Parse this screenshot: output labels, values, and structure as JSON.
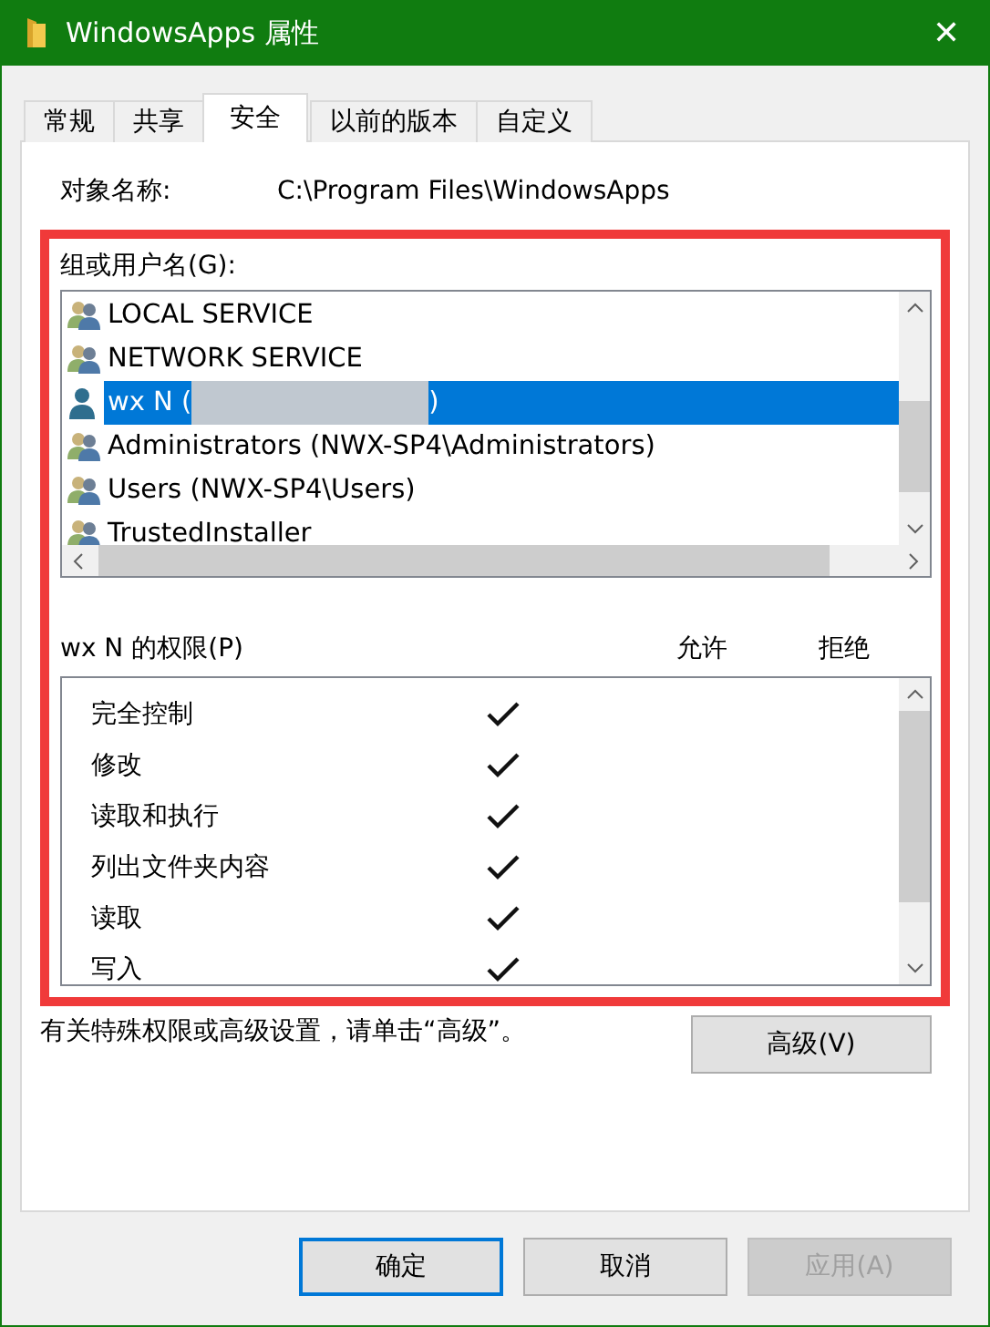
{
  "window": {
    "title": "WindowsApps 属性",
    "close": "✕"
  },
  "tabs": [
    {
      "label": "常规",
      "selected": false
    },
    {
      "label": "共享",
      "selected": false
    },
    {
      "label": "安全",
      "selected": true
    },
    {
      "label": "以前的版本",
      "selected": false
    },
    {
      "label": "自定义",
      "selected": false
    }
  ],
  "object_name": {
    "label": "对象名称:",
    "value": "C:\\Program Files\\WindowsApps"
  },
  "groups": {
    "label": "组或用户名(G):",
    "items": [
      {
        "kind": "group",
        "label": "LOCAL SERVICE",
        "selected": false
      },
      {
        "kind": "group",
        "label": "NETWORK SERVICE",
        "selected": false
      },
      {
        "kind": "user",
        "label": "wx N (",
        "label_end": ")",
        "redacted": true,
        "selected": true
      },
      {
        "kind": "group",
        "label": "Administrators (NWX-SP4\\Administrators)",
        "selected": false
      },
      {
        "kind": "group",
        "label": "Users (NWX-SP4\\Users)",
        "selected": false
      },
      {
        "kind": "group",
        "label": "TrustedInstaller",
        "selected": false
      }
    ]
  },
  "permissions": {
    "label": "wx N 的权限(P)",
    "allow_header": "允许",
    "deny_header": "拒绝",
    "rows": [
      {
        "label": "完全控制",
        "allow": true,
        "deny": false
      },
      {
        "label": "修改",
        "allow": true,
        "deny": false
      },
      {
        "label": "读取和执行",
        "allow": true,
        "deny": false
      },
      {
        "label": "列出文件夹内容",
        "allow": true,
        "deny": false
      },
      {
        "label": "读取",
        "allow": true,
        "deny": false
      },
      {
        "label": "写入",
        "allow": true,
        "deny": false
      }
    ]
  },
  "advanced_hint": "有关特殊权限或高级设置，请单击“高级”。",
  "advanced_button": "高级(V)",
  "buttons": [
    {
      "label": "确定",
      "disabled": false,
      "default": true
    },
    {
      "label": "取消",
      "disabled": false,
      "default": false
    },
    {
      "label": "应用(A)",
      "disabled": true,
      "default": false
    }
  ]
}
